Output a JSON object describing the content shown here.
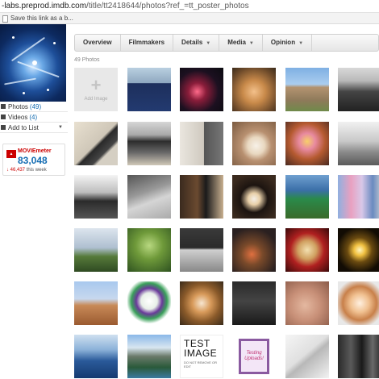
{
  "browser": {
    "url_host": "-labs.preprod.imdb.com",
    "url_path": "/title/tt2418644/photos?ref_=tt_poster_photos",
    "bookmark": "Save this link as a b..."
  },
  "sidebar": {
    "photos_label": "Photos",
    "photos_count": "(49)",
    "videos_label": "Videos",
    "videos_count": "(4)",
    "add_to_list": "Add to List"
  },
  "moviemeter": {
    "title": "MOVIEmeter",
    "rank": "83,048",
    "change": "↓ 46,437",
    "change_suffix": "this week",
    "accent": "#cc0000",
    "rank_color": "#136cb2"
  },
  "tabs": [
    {
      "label": "Overview",
      "dropdown": false
    },
    {
      "label": "Filmmakers",
      "dropdown": false
    },
    {
      "label": "Details",
      "dropdown": true
    },
    {
      "label": "Media",
      "dropdown": true
    },
    {
      "label": "Opinion",
      "dropdown": true
    }
  ],
  "photo_count": "49 Photos",
  "add_image_label": "Add Image",
  "test_image": {
    "line1": "TEST",
    "line2": "IMAGE",
    "fine_print": "DO NOT REMOVE OR EDIT"
  },
  "testing_card": "Testing Uploads!",
  "thumbnails": [
    [
      "add-image",
      "graduation-crowd-photo",
      "neon-sign-photo",
      "cats-photo",
      "canyon-landscape-photo",
      "rocky-mountain-photo"
    ],
    [
      "phone-on-desk-photo",
      "computer-desk-photo",
      "office-door-photo",
      "cat-on-floor-photo",
      "costume-child-photo",
      "office-window-photo"
    ],
    [
      "office-room-photo",
      "laptop-photo",
      "man-rotated-photo",
      "dog-face-photo",
      "sign-post-photo",
      "costume-group-photo"
    ],
    [
      "cloudy-sky-photo",
      "green-foliage-photo",
      "desk-monitor-photo",
      "cafe-interior-photo",
      "pastry-plate-photo",
      "lamp-photo"
    ],
    [
      "man-canyon-photo",
      "toy-figure-photo",
      "puppy-photo",
      "dark-room-photo",
      "blurred-photo",
      "fluffy-dog-photo"
    ],
    [
      "lake-swimmer-photo",
      "mountain-lake-photo",
      "test-image",
      "testing-card",
      "laptop-keyboard-photo",
      "people-crowd-photo"
    ]
  ]
}
